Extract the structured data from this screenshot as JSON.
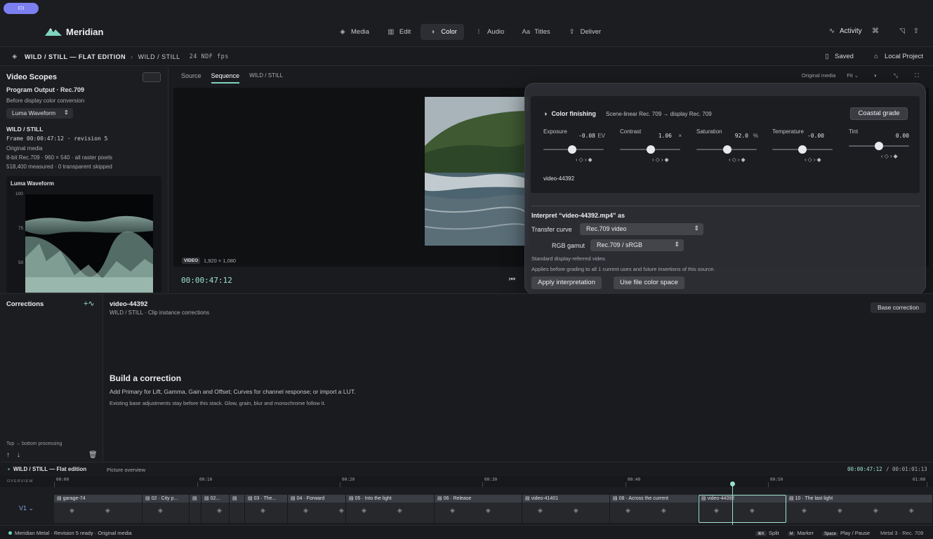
{
  "window": {
    "pill_icon": "display-icon"
  },
  "app": {
    "name": "Meridian"
  },
  "nav": [
    {
      "label": "Media",
      "icon": "layers-icon",
      "active": false
    },
    {
      "label": "Edit",
      "icon": "film-icon",
      "active": false
    },
    {
      "label": "Color",
      "icon": "contrast-icon",
      "active": true
    },
    {
      "label": "Audio",
      "icon": "waveform-icon",
      "active": false
    },
    {
      "label": "Titles",
      "icon": "text-icon",
      "active": false
    },
    {
      "label": "Deliver",
      "icon": "share-icon",
      "active": false
    }
  ],
  "header": {
    "activity": "Activity"
  },
  "breadcrumb": {
    "project": "WILD / STILL — FLAT EDITION",
    "sequence": "WILD / STILL",
    "fps": "24 NDF fps",
    "saved": "Saved",
    "location": "Local Project"
  },
  "scopes": {
    "title": "Video Scopes",
    "output": "Program Output · Rec.709",
    "before": "Before display color conversion",
    "selected": "Luma Waveform",
    "clip": "WILD / STILL",
    "frame": "Frame 00:00:47:12 · revision 5",
    "media": "Original media",
    "format": "8-bit Rec.709 · 960 × 540 · all raster pixels",
    "measured": "518,400 measured · 0 transparent skipped",
    "waveform_title": "Luma Waveform",
    "ticks": [
      "100",
      "75",
      "50"
    ]
  },
  "viewer": {
    "tabs": [
      {
        "label": "Source",
        "active": false
      },
      {
        "label": "Sequence",
        "active": true
      },
      {
        "label": "WILD / STILL",
        "active": false
      }
    ],
    "original_media": "Original media",
    "fit": "Fit",
    "badge": "VIDEO",
    "resolution": "1,920 × 1,080",
    "timecode": "00:00:47:12"
  },
  "color_finishing": {
    "title": "Color finishing",
    "subtitle": "Scene-linear Rec. 709 → display Rec. 709",
    "preset": "Coastal grade",
    "clip": "video-44392",
    "sliders": [
      {
        "label": "Exposure",
        "value": "-0.08",
        "unit": "EV",
        "level": 0.48
      },
      {
        "label": "Contrast",
        "value": "1.06",
        "unit": "×",
        "level": 0.51
      },
      {
        "label": "Saturation",
        "value": "92.0",
        "unit": "%",
        "level": 0.51
      },
      {
        "label": "Temperature",
        "value": "-0.00",
        "unit": "",
        "level": 0.5
      },
      {
        "label": "Tint",
        "value": "0.00",
        "unit": "",
        "level": 0.5
      }
    ]
  },
  "interpret": {
    "title": "Interpret “video-44392.mp4” as",
    "transfer_label": "Transfer curve",
    "transfer_value": "Rec.709 video",
    "gamut_label": "RGB gamut",
    "gamut_value": "Rec.709 / sRGB",
    "note1": "Standard display-referred video.",
    "note2": "Applies before grading to all 1 current uses and future insertions of this source.",
    "apply": "Apply interpretation",
    "use_file": "Use file color space"
  },
  "corrections": {
    "title": "Corrections",
    "order": "Top → bottom processing",
    "clip": "video-44392",
    "clip_sub": "WILD / STILL · Clip instance corrections",
    "base": "Base correction",
    "build_title": "Build a correction",
    "build_sub": "Add Primary for Lift, Gamma, Gain and Offset; Curves for channel response; or import a LUT.",
    "build_note": "Existing base adjustments stay before this stack. Glow, grain, blur and monochrome follow it."
  },
  "timeline": {
    "name": "WILD / STILL — Flat edition",
    "overview": "Picture overview",
    "timecode": "00:00:47:12",
    "total": "/ 00:01:01:13",
    "ruler_label": "OVERVIEW",
    "ticks": [
      "00:00",
      "00:10",
      "00:20",
      "00:30",
      "00:40",
      "00:50",
      "01:00"
    ],
    "track": "V1",
    "clips": [
      {
        "label": "garage-74"
      },
      {
        "label": "02 · City p..."
      },
      {
        "label": ""
      },
      {
        "label": "02..."
      },
      {
        "label": ""
      },
      {
        "label": "03 · The..."
      },
      {
        "label": "04 · Forward"
      },
      {
        "label": "05 · Into the light"
      },
      {
        "label": "06 · Release"
      },
      {
        "label": "video-41401"
      },
      {
        "label": "08 · Across the current"
      },
      {
        "label": "video-44392"
      },
      {
        "label": "10 · The last light"
      }
    ]
  },
  "status": {
    "left": "Meridian Metal · Revision 5 ready · Original media",
    "keys": [
      {
        "key": "⌘K",
        "label": "Split"
      },
      {
        "key": "M",
        "label": "Marker"
      },
      {
        "key": "Space",
        "label": "Play / Pause"
      }
    ],
    "right": "Metal 3 · Rec. 709"
  }
}
